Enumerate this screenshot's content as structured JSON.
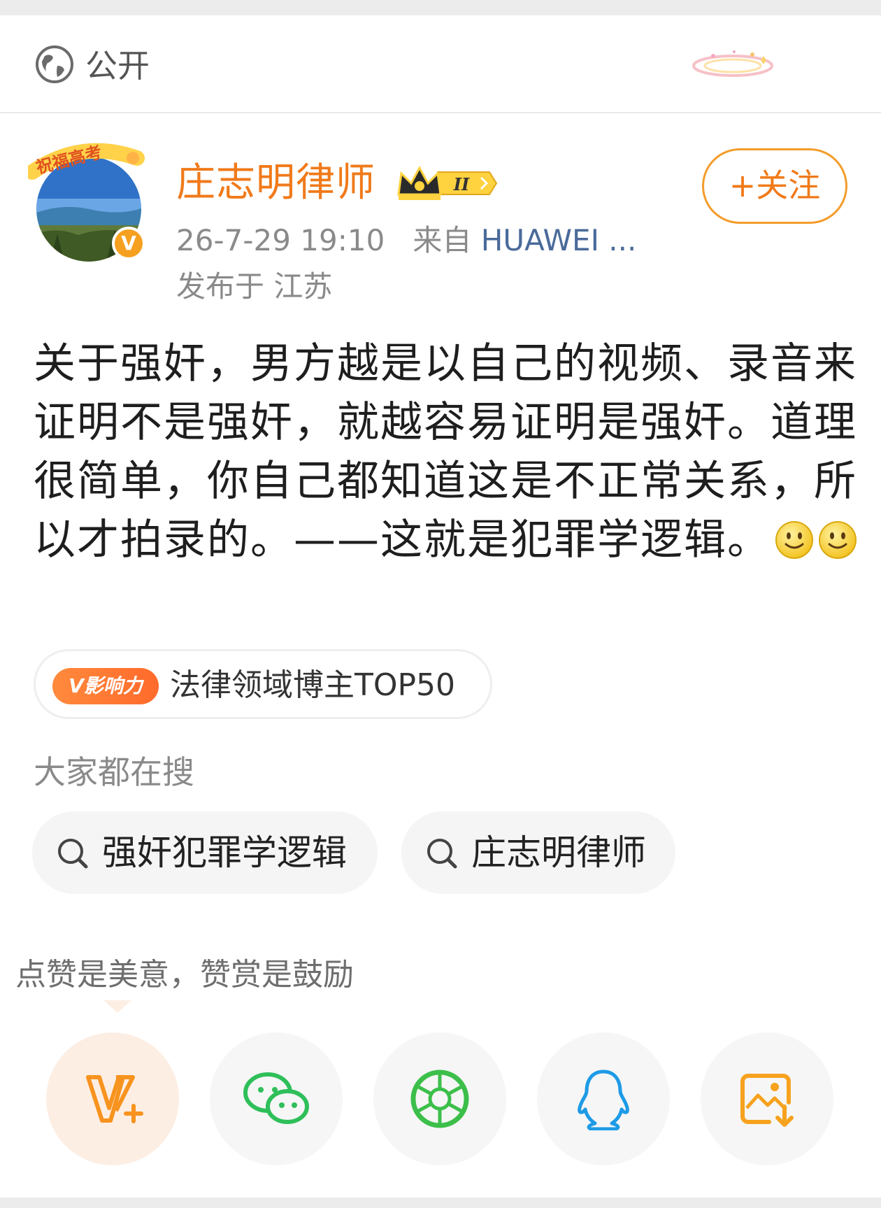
{
  "visibility": {
    "label": "公开",
    "icon": "globe-icon"
  },
  "author": {
    "name": "庄志明律师",
    "avatar_frame_text": "祝福高考",
    "verified_badge": "V",
    "vip_level": "II",
    "follow_label": "+关注"
  },
  "meta": {
    "datetime": "26-7-29 19:10",
    "source_prefix": "来自",
    "source": "HUAWEI ...",
    "location": "发布于 江苏"
  },
  "post": {
    "text": "关于强奸，男方越是以自己的视频、录音来证明不是强奸，就越容易证明是强奸。道理很简单，你自己都知道这是不正常关系，所以才拍录的。——这就是犯罪学逻辑。",
    "emojis": [
      "smile-emoji",
      "smile-emoji"
    ]
  },
  "influence": {
    "tag": "V影响力",
    "text": "法律领域博主TOP50"
  },
  "search": {
    "heading": "大家都在搜",
    "items": [
      {
        "label": "强奸犯罪学逻辑",
        "icon": "search-icon"
      },
      {
        "label": "庄志明律师",
        "icon": "search-icon"
      }
    ]
  },
  "reward": {
    "text": "点赞是美意，赞赏是鼓励"
  },
  "share": [
    {
      "name": "v-plus",
      "icon": "v-plus-icon",
      "color": "#f7931e"
    },
    {
      "name": "wechat",
      "icon": "wechat-icon",
      "color": "#2fbf5a"
    },
    {
      "name": "moments",
      "icon": "moments-icon",
      "color": "#3cbf4a"
    },
    {
      "name": "qq",
      "icon": "qq-icon",
      "color": "#1e9be6"
    },
    {
      "name": "save-image",
      "icon": "save-image-icon",
      "color": "#f7a21e"
    }
  ],
  "colors": {
    "accent": "#f07a1a",
    "follow_border": "#f39c2b",
    "source_link": "#4a6a9a"
  }
}
